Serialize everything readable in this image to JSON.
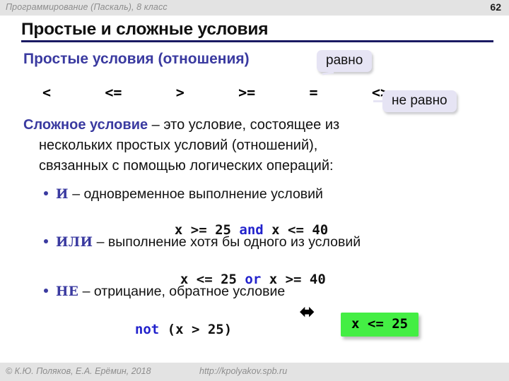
{
  "header": {
    "title": "Программирование (Паскаль), 8 класс",
    "page_number": "62"
  },
  "slide": {
    "title": "Простые и сложные условия",
    "subhead": "Простые условия (отношения)"
  },
  "operators": [
    "<",
    "<=",
    ">",
    ">=",
    "=",
    "<>"
  ],
  "callouts": {
    "equal": "равно",
    "not_equal": "не равно"
  },
  "definition": {
    "term": "Сложное условие",
    "line1": " – это условие, состоящее из",
    "line2": "нескольких простых условий (отношений),",
    "line3": "связанных с помощью логических операций:"
  },
  "bullets": [
    {
      "keyword": "И",
      "text": " – одновременное выполнение условий"
    },
    {
      "keyword": "ИЛИ",
      "text": " – выполнение хотя бы одного из условий"
    },
    {
      "keyword": "НЕ",
      "text": " – отрицание, обратное условие"
    }
  ],
  "code": {
    "and_pre": "x >= 25 ",
    "and_kw": "and",
    "and_post": " x <= 40",
    "or_pre": "x <= 25 ",
    "or_kw": "or",
    "or_post": " x >= 40",
    "not_kw": "not",
    "not_post": " (x > 25)"
  },
  "equiv_symbol": "⬌",
  "result_box": "x <= 25",
  "footer": {
    "copyright": "© К.Ю. Поляков, Е.А. Ерёмин, 2018",
    "url": "http://kpolyakov.spb.ru"
  },
  "colors": {
    "accent": "#3a3aa0",
    "rule": "#1a1a62",
    "keyword": "#2222cc",
    "highlight": "#44ee44",
    "callout_bg": "#e6e4f4",
    "band": "#e3e3e3"
  }
}
